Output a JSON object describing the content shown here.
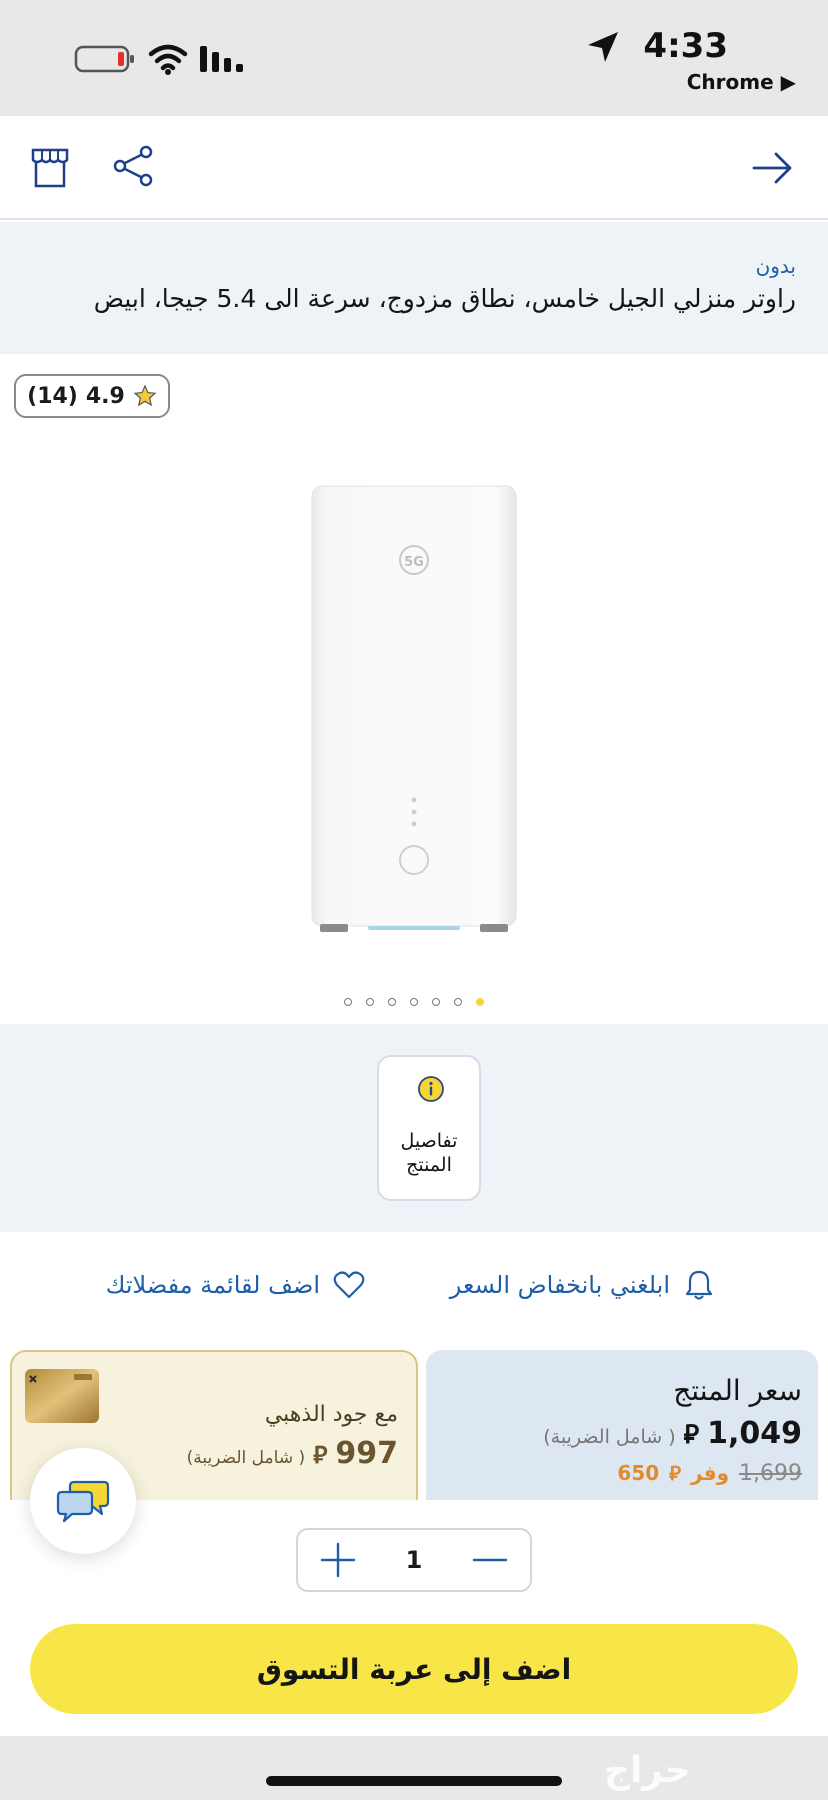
{
  "status_bar": {
    "time": "4:33",
    "back_app": "Chrome ▶"
  },
  "product": {
    "brand": "بدون",
    "title": "راوتر منزلي الجيل خامس، نطاق مزدوج، سرعة الى 5.4 جيجا، ابيض",
    "rating": "4.9",
    "reviews": "(14)",
    "image_label": "5G"
  },
  "carousel": {
    "count": 7,
    "active_index": 6
  },
  "details": {
    "label_line1": "تفاصيل",
    "label_line2": "المنتج"
  },
  "actions": {
    "price_alert": "ابلغني بانخفاض السعر",
    "wishlist": "اضف لقائمة مفضلاتك"
  },
  "price": {
    "label": "سعر المنتج",
    "value": "1,049",
    "currency": "⃁",
    "tax_note": "( شامل الضريبة)",
    "old_price": "1,699",
    "save_label": "وفر",
    "save_amount": "650"
  },
  "gold": {
    "label": "مع جود الذهبي",
    "value": "997",
    "tax_note": "( شامل الضريبة)"
  },
  "quantity": {
    "value": "1"
  },
  "cart": {
    "add_label": "اضف إلى عربة التسوق"
  },
  "watermark": "حراج",
  "colors": {
    "accent": "#1e5ea8",
    "button": "#f8e547",
    "save": "#e48a2c"
  }
}
